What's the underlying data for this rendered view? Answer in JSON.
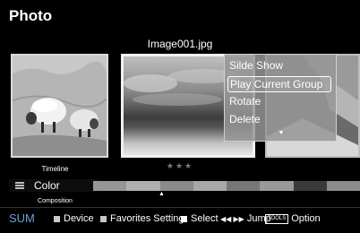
{
  "title": "Photo",
  "filename": "Image001.jpg",
  "context_menu": {
    "items": [
      "Silde Show",
      "Play Current Group",
      "Rotate",
      "Delete"
    ],
    "selected_index": 1,
    "more_icon": "down-arrow-icon"
  },
  "rating_stars": "★★★",
  "sort_panel": {
    "above": "Timeline",
    "current": "Color",
    "below": "Composition"
  },
  "footer": {
    "sum": "SUM",
    "device": "Device",
    "favorites": "Favorites Setting",
    "select": "Select",
    "jump_arrows": "◀◀ ▶▶",
    "jump": "Jump",
    "tools": "TOOLS",
    "option": "Option"
  },
  "colors": {
    "sum": "#6ea0d0",
    "device_button": "#c8c8c8",
    "favorites_button": "#c8c8c8",
    "select_button": "#ffffff"
  },
  "color_strip": [
    "#969696",
    "#b0b0b0",
    "#8a8a8a",
    "#a8a8a8",
    "#777777",
    "#999999",
    "#3a3a3a",
    "#8c8c8c"
  ]
}
